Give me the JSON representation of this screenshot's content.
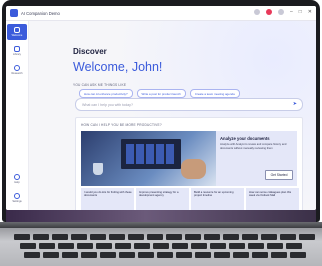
{
  "app": {
    "title": "AI Companion Demo"
  },
  "titlebar": {
    "minimize": "–",
    "maximize": "□",
    "close": "✕"
  },
  "sidebar": {
    "items": [
      {
        "label": "Welcome",
        "icon": "compass-icon",
        "active": true
      },
      {
        "label": "Library",
        "icon": "bag-icon",
        "active": false
      },
      {
        "label": "Research",
        "icon": "clock-icon",
        "active": false
      },
      {
        "label": "Help",
        "icon": "question-icon",
        "active": false
      },
      {
        "label": "Settings",
        "icon": "gear-icon",
        "active": false
      }
    ]
  },
  "main": {
    "discover_title": "Discover",
    "welcome": "Welcome, John!",
    "ask_label": "YOU CAN ASK ME THINGS LIKE",
    "chips": [
      "How can AI enhance productivity?",
      "Write a post for product launch",
      "Create a team meeting agenda"
    ],
    "search_placeholder": "What can I help you with today?",
    "help_title": "HOW CAN I HELP YOU BE MORE PRODUCTIVE?",
    "feature": {
      "heading": "Analyze your documents",
      "description": "Analyze with Analyst to review and compare history and documents without manually reviewing them",
      "button": "Get Started"
    },
    "mini_cards": [
      "I would you do lots for finding with these documents",
      "Improve presenting strategy for a development agency",
      "Build a resource for an upcoming project timeline",
      "How can some colleagues plan this week via Outlook Mail"
    ]
  },
  "colors": {
    "accent": "#3b5bdb",
    "close": "#e8395a"
  }
}
